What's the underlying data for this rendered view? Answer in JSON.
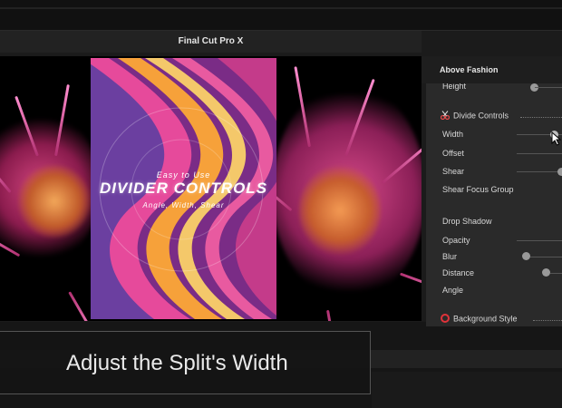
{
  "app": {
    "title": "Final Cut Pro X"
  },
  "viewer": {
    "card": {
      "subtitle": "Easy to Use",
      "logo": "DIVIDER CONTROLS",
      "tagline": "Angle, Width, Shear"
    },
    "caption": "Adjust the Split's Width"
  },
  "inspector": {
    "title": "Above Fashion",
    "rows": {
      "height": "Height",
      "divide_controls": "Divide Controls",
      "width": "Width",
      "offset": "Offset",
      "shear": "Shear",
      "shear_focus_group": "Shear Focus Group",
      "drop_shadow": "Drop Shadow",
      "opacity": "Opacity",
      "blur": "Blur",
      "distance": "Distance",
      "angle": "Angle",
      "background_style": "Background Style"
    }
  },
  "icons": {
    "divide": "scissors-icon",
    "background": "red-circle-icon"
  },
  "colors": {
    "accent_pink": "#e64a9b",
    "orange": "#f6a13a",
    "purple": "#7a2c86"
  }
}
